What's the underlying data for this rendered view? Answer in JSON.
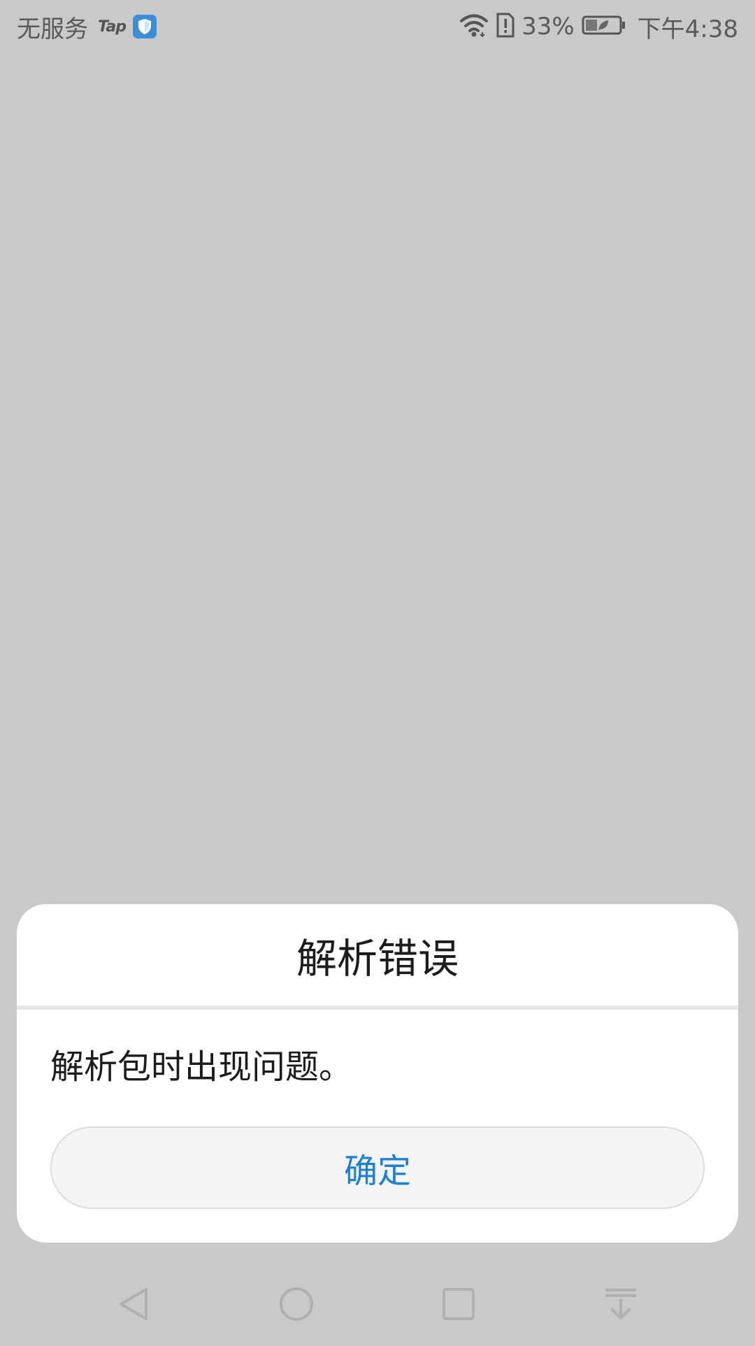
{
  "status_bar": {
    "carrier": "无服务",
    "app_label": "Tap",
    "battery_percent": "33%",
    "time": "下午4:38",
    "icons": [
      "shield-icon",
      "wifi-icon",
      "sim-alert-icon",
      "battery-icon"
    ]
  },
  "dialog": {
    "title": "解析错误",
    "message": "解析包时出现问题。",
    "ok_label": "确定",
    "accent_color": "#1e7fd6"
  },
  "nav_bar": {
    "icons": [
      "back-icon",
      "home-icon",
      "recents-icon",
      "notification-shade-icon"
    ]
  }
}
